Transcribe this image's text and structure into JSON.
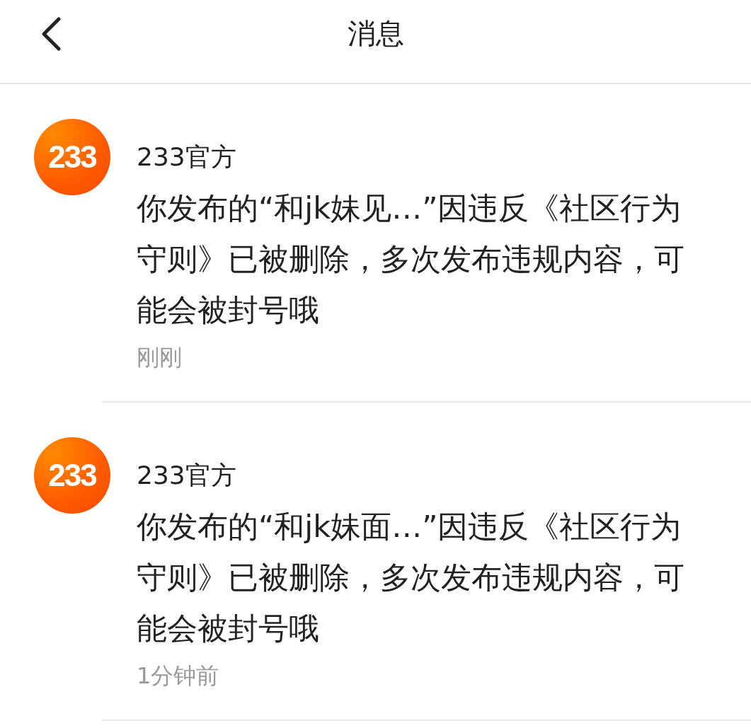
{
  "header": {
    "title": "消息"
  },
  "messages": [
    {
      "avatar_text": "233",
      "sender": "233官方",
      "text": "你发布的“和jk妹见…”因违反《社区行为守则》已被删除，多次发布违规内容，可能会被封号哦",
      "time": "刚刚"
    },
    {
      "avatar_text": "233",
      "sender": "233官方",
      "text": "你发布的“和jk妹面…”因违反《社区行为守则》已被删除，多次发布违规内容，可能会被封号哦",
      "time": "1分钟前"
    }
  ]
}
